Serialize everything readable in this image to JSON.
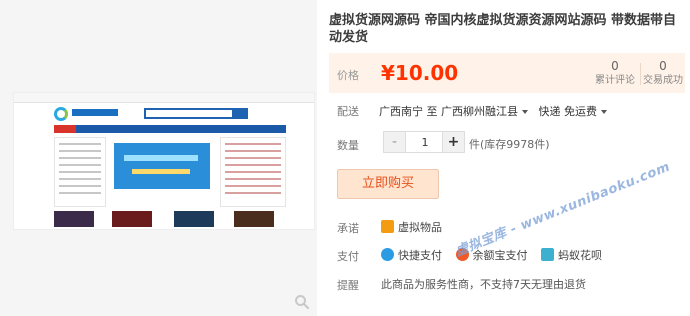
{
  "product": {
    "title": "虚拟货源网源码 帝国内核虚拟货源资源网站源码 带数据带自动发货"
  },
  "price": {
    "label": "价格",
    "value": "¥10.00",
    "reviews_count": "0",
    "reviews_label": "累计评论",
    "sales_count": "0",
    "sales_label": "交易成功"
  },
  "shipping": {
    "label": "配送",
    "from_to": "广西南宁 至",
    "destination": "广西柳州融江县",
    "method": "快递 免运费"
  },
  "quantity": {
    "label": "数量",
    "minus": "-",
    "value": "1",
    "plus": "+",
    "stock": "件(库存9978件)"
  },
  "buy_button": "立即购买",
  "promise": {
    "label": "承诺",
    "item": "虚拟物品"
  },
  "payment": {
    "label": "支付",
    "items": [
      "快捷支付",
      "余额宝支付",
      "蚂蚁花呗"
    ]
  },
  "remind": {
    "label": "提醒",
    "text": "此商品为服务性商，不支持7天无理由退货"
  },
  "watermark": "虚拟宝库 - www.xunibaoku.com",
  "colors": {
    "accent": "#ff3300",
    "price_bg": "#fff2e8",
    "buy_bg": "#ffe4d0"
  },
  "icons": {
    "zoom": "magnifier-icon"
  }
}
